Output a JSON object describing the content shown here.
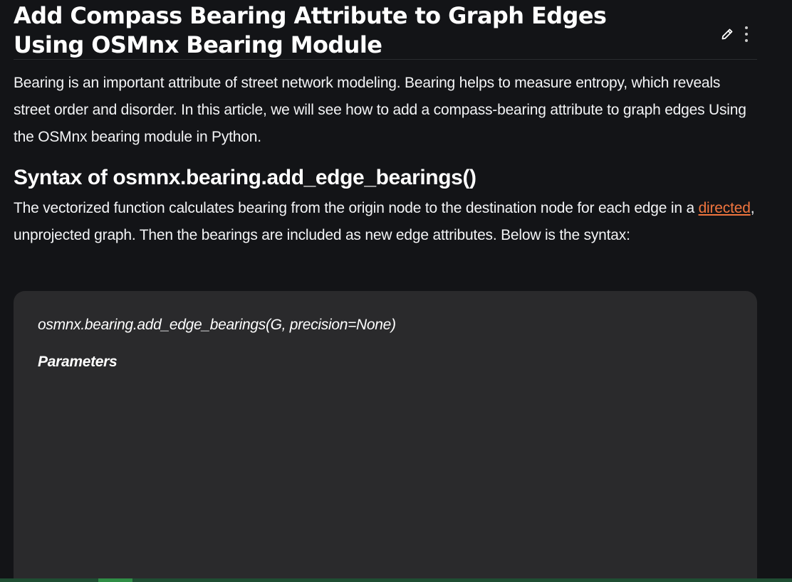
{
  "article": {
    "title": "Add Compass Bearing Attribute to Graph Edges Using OSMnx Bearing Module",
    "intro": "Bearing is an important attribute of street network modeling. Bearing helps to measure entropy, which reveals street order and disorder. In this article, we will see how to add a compass-bearing attribute to graph edges Using the OSMnx bearing module in Python.",
    "section_heading": "Syntax of osmnx.bearing.add_edge_bearings()",
    "desc_before_link": "The vectorized function calculates bearing from the origin node to the destination node for each edge in a ",
    "desc_link": "directed",
    "desc_after_link": ", unprojected graph. Then the bearings are included as new edge attributes. Below is the syntax:",
    "code_signature": "osmnx.bearing.add_edge_bearings(G, precision=None)",
    "code_params_label": "Parameters"
  },
  "icons": {
    "edit": "pencil-icon",
    "more": "more-vertical-icon"
  },
  "colors": {
    "background": "#131417",
    "link": "#f0753e",
    "code_background": "#2a2a2c",
    "accent_green": "#2f8d46"
  }
}
